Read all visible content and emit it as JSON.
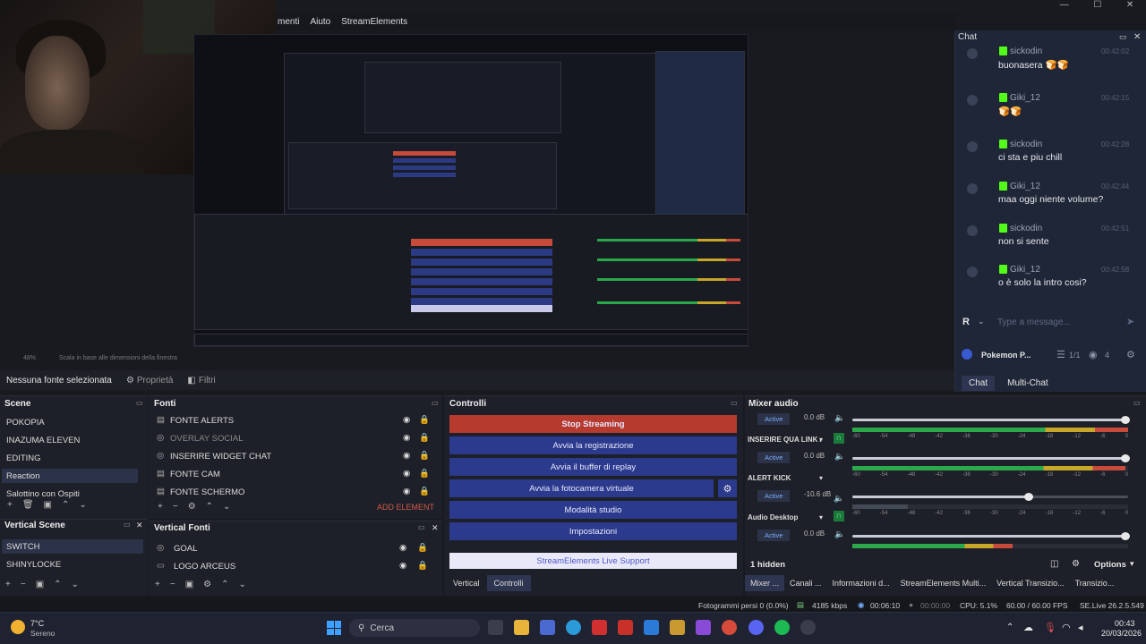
{
  "menubar": {
    "items": [
      "menti",
      "Aiuto",
      "StreamElements"
    ]
  },
  "preview": {
    "zoom_level": "48%",
    "zoom_hint": "Scala in base alle dimensioni della finestra"
  },
  "chat": {
    "title": "Chat",
    "messages": [
      {
        "user": "sickodin",
        "time": "00:42:02",
        "text": "buonasera 🍞🍞"
      },
      {
        "user": "Giki_12",
        "time": "00:42:15",
        "text": "🍞🍞"
      },
      {
        "user": "sickodin",
        "time": "00:42:28",
        "text": "ci sta e piu chill"
      },
      {
        "user": "Giki_12",
        "time": "00:42:44",
        "text": "maa oggi niente volume?"
      },
      {
        "user": "sickodin",
        "time": "00:42:51",
        "text": "non si sente"
      },
      {
        "user": "Giki_12",
        "time": "00:42:58",
        "text": "o è solo la intro cosi?"
      }
    ],
    "input_placeholder": "Type a message...",
    "input_prefix": "R",
    "channel": "Pokemon P...",
    "viewer_ratio": "1/1",
    "viewers": "4",
    "tabs": [
      "Chat",
      "Multi-Chat"
    ]
  },
  "source_bar": {
    "no_source": "Nessuna fonte selezionata",
    "properties": "Proprietà",
    "filters": "Filtri"
  },
  "scenes": {
    "title": "Scene",
    "items": [
      "POKOPIA",
      "INAZUMA ELEVEN",
      "EDITING",
      "Reaction",
      "Salottino con Ospiti"
    ],
    "selected": "Reaction"
  },
  "vertical_scenes": {
    "title": "Vertical Scene",
    "items": [
      "SWITCH",
      "SHINYLOCKE"
    ]
  },
  "sources": {
    "title": "Fonti",
    "items": [
      "FONTE ALERTS",
      "OVERLAY SOCIAL",
      "INSERIRE WIDGET CHAT",
      "FONTE CAM",
      "FONTE SCHERMO"
    ],
    "add_element": "ADD ELEMENT"
  },
  "vertical_sources": {
    "title": "Vertical Fonti",
    "items": [
      "GOAL",
      "LOGO ARCEUS"
    ]
  },
  "controls": {
    "title": "Controlli",
    "stop_streaming": "Stop Streaming",
    "start_recording": "Avvia la registrazione",
    "replay_buffer": "Avvia il buffer di replay",
    "virtual_camera": "Avvia la fotocamera virtuale",
    "studio_mode": "Modalità studio",
    "settings": "Impostazioni",
    "se_support": "StreamElements Live Support",
    "tabs": [
      "Vertical",
      "Controlli"
    ]
  },
  "mixer": {
    "title": "Mixer audio",
    "channels": [
      {
        "name": "",
        "db": "0.0 dB",
        "active": "Active"
      },
      {
        "name": "INSERIRE QUA LINK AL",
        "db": "0.0 dB",
        "active": "Active"
      },
      {
        "name": "ALERT KICK",
        "db": "-10.6 dB",
        "active": "Active"
      },
      {
        "name": "Audio Desktop",
        "db": "0.0 dB",
        "active": "Active"
      }
    ],
    "scale": [
      "-60",
      "-54",
      "-48",
      "-42",
      "-36",
      "-30",
      "-24",
      "-18",
      "-12",
      "-6",
      "0"
    ],
    "hidden": "1 hidden",
    "options": "Options"
  },
  "bottom_tabs": [
    "Mixer ...",
    "Canali ...",
    "Informazioni d...",
    "StreamElements Multi...",
    "Vertical Transizio...",
    "Transizio..."
  ],
  "status": {
    "frames_lost": "Fotogrammi persi 0 (0.0%)",
    "bitrate": "4185 kbps",
    "stream_time": "00:06:10",
    "rec_time": "00:00:00",
    "cpu": "CPU: 5.1%",
    "fps": "60.00 / 60.00 FPS",
    "se_version": "SE.Live 26.2.5.549"
  },
  "taskbar": {
    "weather_temp": "7°C",
    "weather_desc": "Sereno",
    "search": "Cerca",
    "time": "00:43",
    "date": "20/03/2026"
  }
}
